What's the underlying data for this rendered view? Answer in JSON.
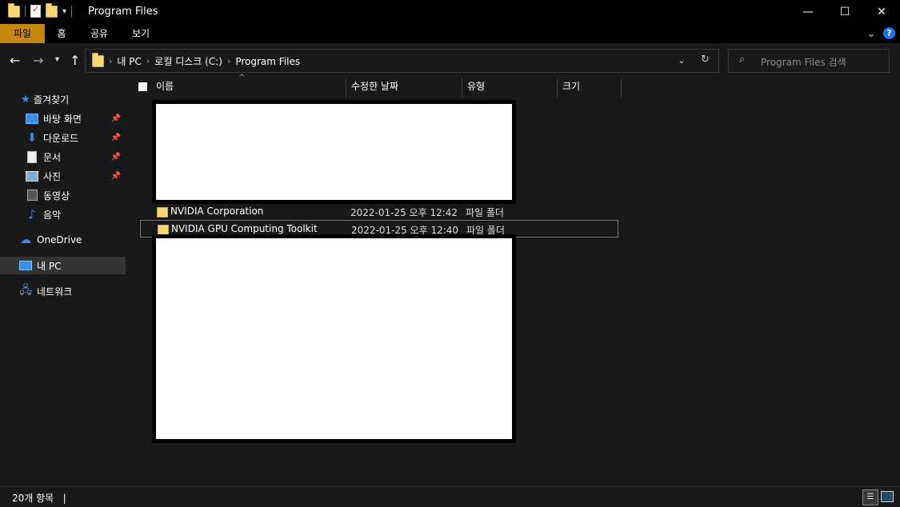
{
  "window": {
    "title": "Program Files",
    "minimize": "—",
    "maximize": "☐",
    "close": "✕"
  },
  "ribbon": {
    "tabs": [
      {
        "label": "파일"
      },
      {
        "label": "홈"
      },
      {
        "label": "공유"
      },
      {
        "label": "보기"
      }
    ],
    "help": "?"
  },
  "address": {
    "crumbs": [
      "내 PC",
      "로컬 디스크 (C:)",
      "Program Files"
    ],
    "search_placeholder": "Program Files 검색"
  },
  "sidebar": {
    "quick_access": "즐겨찾기",
    "items": [
      {
        "label": "바탕 화면",
        "icon": "desktop-icon",
        "pinned": true
      },
      {
        "label": "다운로드",
        "icon": "download-icon",
        "pinned": true
      },
      {
        "label": "문서",
        "icon": "document-icon",
        "pinned": true
      },
      {
        "label": "사진",
        "icon": "picture-icon",
        "pinned": true
      },
      {
        "label": "동영상",
        "icon": "video-icon",
        "pinned": false
      },
      {
        "label": "음악",
        "icon": "music-icon",
        "pinned": false
      }
    ],
    "onedrive": "OneDrive",
    "this_pc": "내 PC",
    "network": "네트워크"
  },
  "columns": {
    "name": "이름",
    "date": "수정한 날짜",
    "type": "유형",
    "size": "크기"
  },
  "files": [
    {
      "name": "NVIDIA Corporation",
      "date": "2022-01-25 오후 12:42",
      "type": "파일 폴더",
      "selected": false
    },
    {
      "name": "NVIDIA GPU Computing Toolkit",
      "date": "2022-01-25 오후 12:40",
      "type": "파일 폴더",
      "selected": true
    }
  ],
  "status": {
    "count": "20개 항목"
  },
  "colors": {
    "background": "#191919",
    "titlebar": "#000000",
    "file_tab": "#c6870f",
    "folder": "#f8d775",
    "help": "#1a73e8"
  }
}
